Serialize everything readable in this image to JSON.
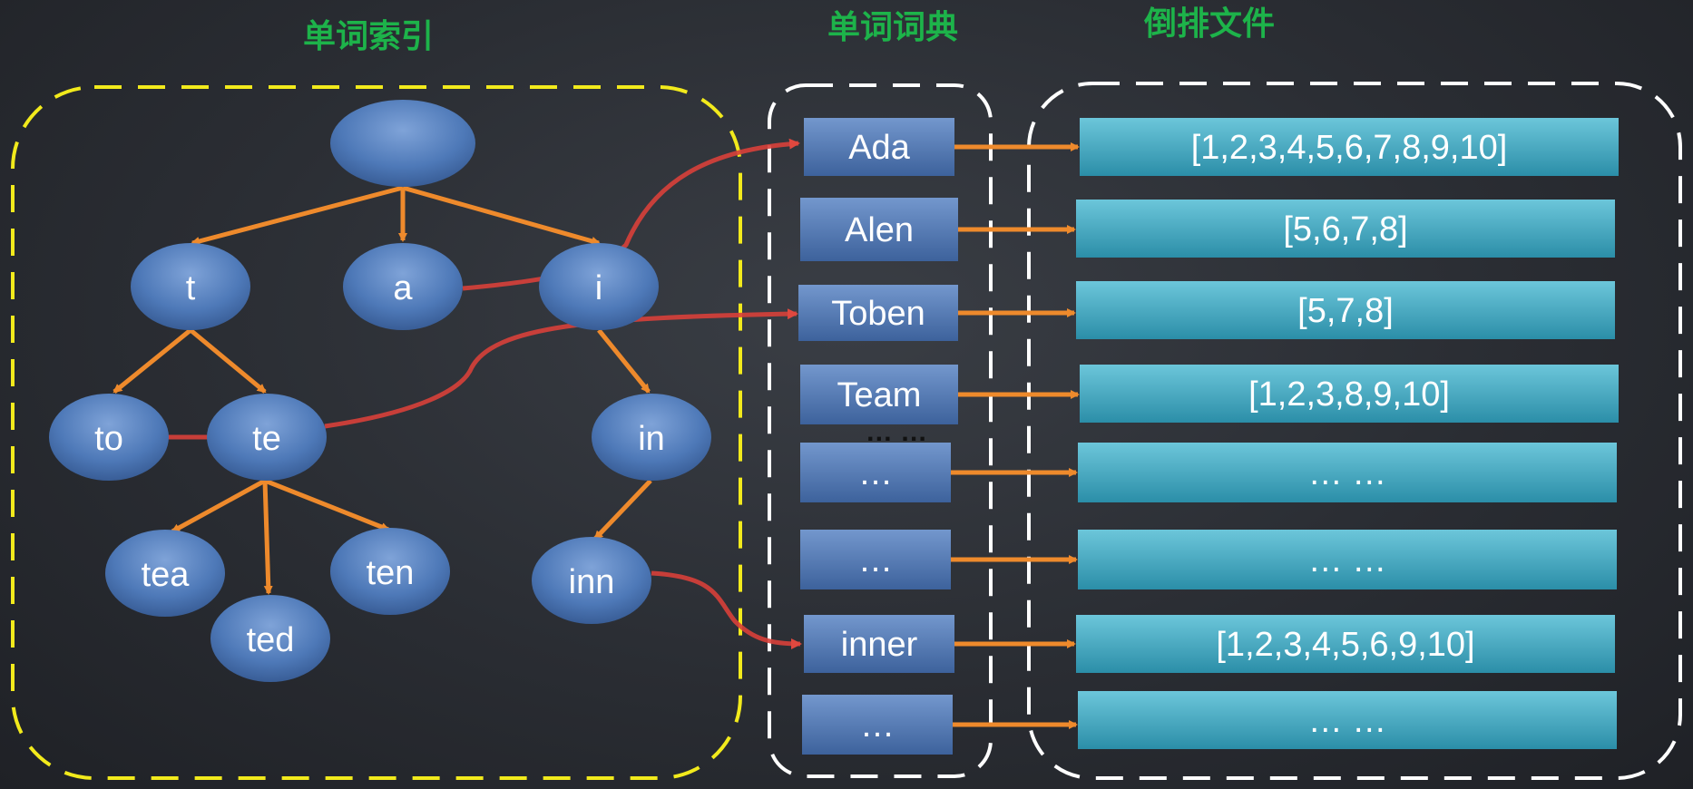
{
  "headings": {
    "index": "单词索引",
    "dictionary": "单词词典",
    "inverted_file": "倒排文件"
  },
  "trie": {
    "root": "",
    "nodes": {
      "t": "t",
      "a": "a",
      "i": "i",
      "to": "to",
      "te": "te",
      "in": "in",
      "tea": "tea",
      "ted": "ted",
      "ten": "ten",
      "inn": "inn"
    }
  },
  "dictionary": [
    "Ada",
    "Alen",
    "Toben",
    "Team",
    "…",
    "…",
    "inner",
    "…"
  ],
  "dictionary_gap": "… …",
  "postings": [
    "[1,2,3,4,5,6,7,8,9,10]",
    "[5,6,7,8]",
    "[5,7,8]",
    "[1,2,3,8,9,10]",
    "… …",
    "… …",
    "[1,2,3,4,5,6,9,10]",
    "… …"
  ],
  "colors": {
    "heading": "#1db34a",
    "index_border": "#f2ea1c",
    "frame_border": "#ffffff",
    "node": "#4e79b8",
    "dict_box": "#4b74ae",
    "posting_box": "#3aa6c0",
    "arrow": "#ee8a2c",
    "link": "#d8403a"
  }
}
